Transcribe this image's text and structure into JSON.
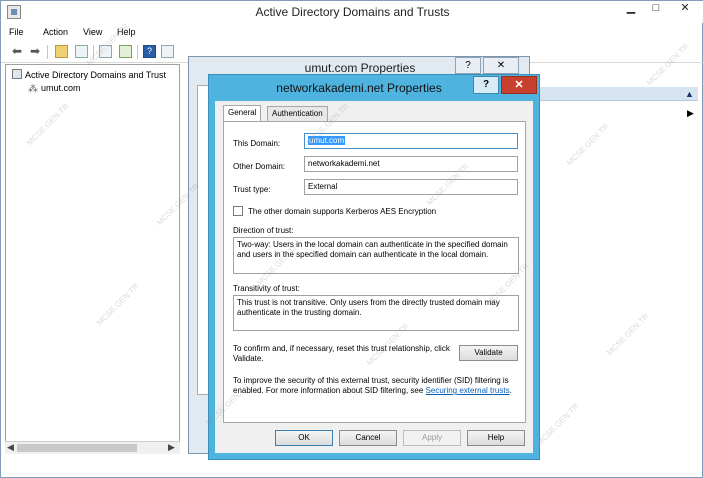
{
  "app": {
    "title": "Active Directory Domains and Trusts",
    "controls": {
      "minimize": "▁",
      "maximize": "□",
      "close": "✕"
    }
  },
  "menu": [
    "File",
    "Action",
    "View",
    "Help"
  ],
  "toolbar_icons": [
    "back-arrow-icon",
    "forward-arrow-icon",
    "folder-up-icon",
    "properties-icon",
    "refresh-icon",
    "export-icon",
    "help-icon",
    "console-tree-icon"
  ],
  "tree": {
    "root": "Active Directory Domains and Trust",
    "child": "umut.com"
  },
  "back_dialog": {
    "title": "umut.com Properties",
    "help": "?",
    "close": "✕"
  },
  "dialog": {
    "title": "networkakademi.net Properties",
    "help": "?",
    "close": "✕",
    "tabs": [
      "General",
      "Authentication"
    ],
    "this_domain_label": "This Domain:",
    "this_domain_value": "umut.com",
    "other_domain_label": "Other Domain:",
    "other_domain_value": "networkakademi.net",
    "trust_type_label": "Trust type:",
    "trust_type_value": "External",
    "kerberos_label": "The other domain supports Kerberos AES Encryption",
    "kerberos_checked": false,
    "direction_label": "Direction of trust:",
    "direction_text": "Two-way: Users in the local domain can authenticate in the specified domain and users in the specified domain can authenticate in the local domain.",
    "transitivity_label": "Transitivity of trust:",
    "transitivity_text": "This trust is not transitive. Only users from the directly trusted domain may authenticate in the trusting domain.",
    "confirm_text": "To confirm and, if necessary, reset this trust relationship, click Validate.",
    "validate_button": "Validate",
    "sid_text": "To improve the security of this external trust, security identifier (SID) filtering is enabled. For more information about SID filtering, see ",
    "sid_link": "Securing external trusts",
    "sid_end": ".",
    "buttons": {
      "ok": "OK",
      "cancel": "Cancel",
      "apply": "Apply",
      "help": "Help"
    }
  },
  "watermark": "MCSE.GEN.TR",
  "colors": {
    "dialog_frame": "#4fb3e0",
    "close_red": "#c7402e",
    "selection": "#3399ff"
  }
}
